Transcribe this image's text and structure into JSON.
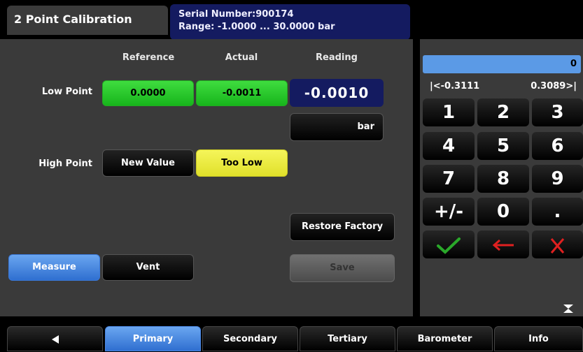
{
  "header": {
    "title": "2 Point Calibration",
    "serial": "Serial Number:900174",
    "range": "Range: -1.0000 ... 30.0000 bar"
  },
  "columns": {
    "reference": "Reference",
    "actual": "Actual",
    "reading": "Reading"
  },
  "low_point": {
    "label": "Low Point",
    "reference": "0.0000",
    "actual": "-0.0011",
    "reading": "-0.0010"
  },
  "unit": "bar",
  "high_point": {
    "label": "High Point",
    "reference_button": "New Value",
    "actual_status": "Too Low"
  },
  "buttons": {
    "restore_factory": "Restore Factory",
    "measure": "Measure",
    "vent": "Vent",
    "save": "Save"
  },
  "keypad": {
    "display_value": "0",
    "min_label": "|<-0.3111",
    "max_label": "0.3089>|",
    "keys": [
      "1",
      "2",
      "3",
      "4",
      "5",
      "6",
      "7",
      "8",
      "9",
      "+/-",
      "0",
      "."
    ],
    "confirm_icon": "check-icon",
    "backspace_icon": "left-arrow-icon",
    "cancel_icon": "x-icon"
  },
  "tabs": {
    "back_icon": "left-triangle-icon",
    "primary": "Primary",
    "secondary": "Secondary",
    "tertiary": "Tertiary",
    "barometer": "Barometer",
    "info": "Info",
    "active": "Primary"
  },
  "colors": {
    "accent_blue": "#3a78d8",
    "green": "#17b51c",
    "yellow": "#e0e02a",
    "navy": "#141b60",
    "cancel_red": "#e02020",
    "confirm_green": "#2aa82a"
  }
}
